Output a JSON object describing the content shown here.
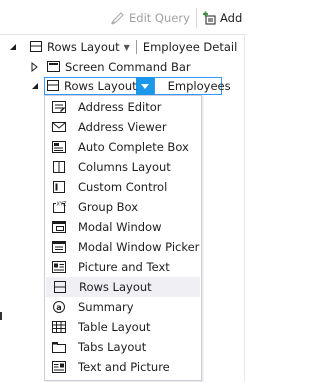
{
  "toolbar": {
    "edit_query_label": "Edit Query",
    "add_label": "Add",
    "edit_query_icon": "edit-query-icon",
    "add_icon": "add-icon"
  },
  "tree": {
    "root": {
      "label": "Rows Layout",
      "target": "Employee Detail"
    },
    "screen_command_bar": {
      "label": "Screen Command Bar"
    },
    "selected": {
      "label": "Rows Layout",
      "target": "Employees"
    }
  },
  "menu": {
    "items": [
      {
        "label": "Address Editor",
        "icon": "address-editor-icon"
      },
      {
        "label": "Address Viewer",
        "icon": "address-viewer-icon"
      },
      {
        "label": "Auto Complete Box",
        "icon": "auto-complete-box-icon"
      },
      {
        "label": "Columns Layout",
        "icon": "columns-layout-icon"
      },
      {
        "label": "Custom Control",
        "icon": "custom-control-icon"
      },
      {
        "label": "Group Box",
        "icon": "group-box-icon"
      },
      {
        "label": "Modal Window",
        "icon": "modal-window-icon"
      },
      {
        "label": "Modal Window Picker",
        "icon": "modal-window-picker-icon"
      },
      {
        "label": "Picture and Text",
        "icon": "picture-and-text-icon"
      },
      {
        "label": "Rows Layout",
        "icon": "rows-layout-icon",
        "highlighted": true
      },
      {
        "label": "Summary",
        "icon": "summary-icon"
      },
      {
        "label": "Table Layout",
        "icon": "table-layout-icon"
      },
      {
        "label": "Tabs Layout",
        "icon": "tabs-layout-icon"
      },
      {
        "label": "Text and Picture",
        "icon": "text-and-picture-icon"
      }
    ]
  },
  "colors": {
    "accent": "#1c97ea",
    "selection_border": "#3399ff",
    "highlight": "#f0f0f4",
    "disabled_text": "#a0a0a0"
  }
}
